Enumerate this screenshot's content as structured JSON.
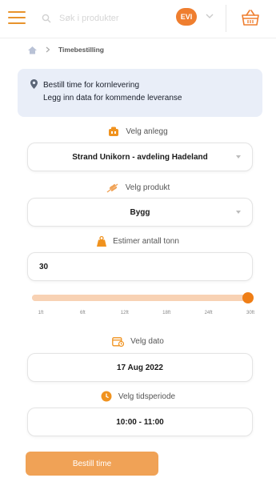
{
  "colors": {
    "accent": "#ef7e2f",
    "info_bg": "#e9eef8",
    "button": "#f0a256"
  },
  "header": {
    "menu_icon": "hamburger-icon",
    "search_placeholder": "Søk i produkter",
    "avatar_text": "EVI",
    "cart_icon": "basket-icon"
  },
  "breadcrumb": {
    "home_icon": "home-icon",
    "current": "Timebestilling"
  },
  "info": {
    "icon": "location-pin-icon",
    "line1": "Bestill time for kornlevering",
    "line2": "Legg inn data for kommende leveranse"
  },
  "form": {
    "facility": {
      "label": "Velg anlegg",
      "value": "Strand Unikorn - avdeling Hadeland"
    },
    "product": {
      "label": "Velg produkt",
      "value": "Bygg"
    },
    "tonnage": {
      "label": "Estimer antall tonn",
      "value": "30",
      "slider_fraction": 1.0,
      "ticks": [
        "1ft",
        "6ft",
        "12ft",
        "18ft",
        "24ft",
        "30ft"
      ]
    },
    "date": {
      "label": "Velg dato",
      "value": "17 Aug 2022"
    },
    "period": {
      "label": "Velg tidsperiode",
      "value": "10:00 - 11:00"
    }
  },
  "submit_label": "Bestill time"
}
